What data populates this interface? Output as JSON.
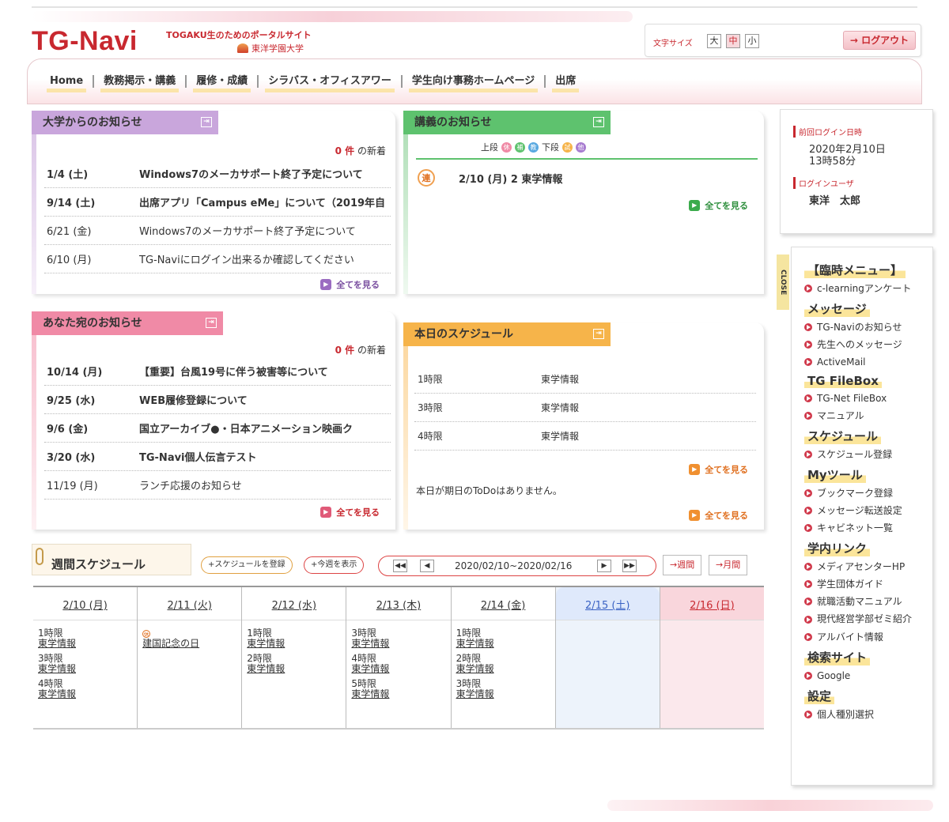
{
  "brand": {
    "logo": "TG-Navi",
    "tagline": "TOGAKU生のためのポータルサイト",
    "university": "東洋学園大学"
  },
  "toolbar": {
    "font_size_label": "文字サイズ",
    "sizes": [
      "大",
      "中",
      "小"
    ],
    "logout_label": "ログアウト"
  },
  "nav": [
    "Home",
    "教務掲示・講義",
    "履修・成績",
    "シラバス・オフィスアワー",
    "学生向け事務ホームページ",
    "出席"
  ],
  "univ_notices": {
    "title": "大学からのお知らせ",
    "new_count_num": "0 件",
    "new_count_suffix": "の新着",
    "items": [
      {
        "date": "1/4 (土)",
        "text": "Windows7のメーカサポート終了予定について"
      },
      {
        "date": "9/14 (土)",
        "text": "出席アプリ「Campus eMe」について（2019年自"
      },
      {
        "date": "6/21 (金)",
        "text": "Windows7のメーカサポート終了予定について"
      },
      {
        "date": "6/10 (月)",
        "text": "TG-Naviにログイン出来るか確認してください"
      }
    ],
    "see_all": "全てを見る"
  },
  "lecture_notices": {
    "title": "講義のお知らせ",
    "upper_label": "上段",
    "lower_label": "下段",
    "badges": [
      "休",
      "補",
      "教",
      "試",
      "他"
    ],
    "item_icon": "連",
    "item_text": "2/10 (月) 2  東学情報",
    "see_all": "全てを見る"
  },
  "my_notices": {
    "title": "あなた宛のお知らせ",
    "new_count_num": "0 件",
    "new_count_suffix": "の新着",
    "items": [
      {
        "date": "10/14 (月)",
        "text": "【重要】台風19号に伴う被害等について"
      },
      {
        "date": "9/25 (水)",
        "text": "WEB履修登録について"
      },
      {
        "date": "9/6 (金)",
        "text": "国立アーカイブ●・日本アニメーション映画ク"
      },
      {
        "date": "3/20 (水)",
        "text": "TG-Navi個人伝言テスト"
      },
      {
        "date": "11/19 (月)",
        "text": "ランチ応援のお知らせ"
      }
    ],
    "see_all": "全てを見る"
  },
  "today_schedule": {
    "title": "本日のスケジュール",
    "items": [
      {
        "period": "1時限",
        "course": "東学情報"
      },
      {
        "period": "3時限",
        "course": "東学情報"
      },
      {
        "period": "4時限",
        "course": "東学情報"
      }
    ],
    "see_all_1": "全てを見る",
    "todo_text": "本日が期日のToDoはありません。",
    "see_all_2": "全てを見る"
  },
  "login_info": {
    "last_login_label": "前回ログイン日時",
    "last_login_date": "2020年2月10日",
    "last_login_time": "13時58分",
    "user_label": "ログインユーザ",
    "user_name": "東洋　太郎"
  },
  "side_menu": {
    "close_label": "CLOSE",
    "sections": [
      {
        "title": "【臨時メニュー】",
        "items": [
          "c-learningアンケート"
        ]
      },
      {
        "title": "メッセージ",
        "items": [
          "TG-Naviのお知らせ",
          "先生へのメッセージ",
          "ActiveMail"
        ]
      },
      {
        "title": "TG FileBox",
        "items": [
          "TG-Net FileBox",
          "マニュアル"
        ]
      },
      {
        "title": "スケジュール",
        "items": [
          "スケジュール登録"
        ]
      },
      {
        "title": "Myツール",
        "items": [
          "ブックマーク登録",
          "メッセージ転送設定",
          "キャビネット一覧"
        ]
      },
      {
        "title": "学内リンク",
        "items": [
          "メディアセンターHP",
          "学生団体ガイド",
          "就職活動マニュアル",
          "現代経営学部ゼミ紹介",
          "アルバイト情報"
        ]
      },
      {
        "title": "検索サイト",
        "items": [
          "Google"
        ]
      },
      {
        "title": "設定",
        "items": [
          "個人種別選択"
        ]
      }
    ]
  },
  "weekly": {
    "title": "週間スケジュール",
    "register_label": "+スケジュールを登録",
    "this_week_label": "+今週を表示",
    "first": "◀◀",
    "prev": "◀",
    "range": "2020/02/10~2020/02/16",
    "next": "▶",
    "last": "▶▶",
    "week_label": "週間",
    "month_label": "月間",
    "days": [
      {
        "label": "2/10 (月)",
        "entries": [
          {
            "p": "1時限",
            "c": "東学情報"
          },
          {
            "p": "3時限",
            "c": "東学情報"
          },
          {
            "p": "4時限",
            "c": "東学情報"
          }
        ]
      },
      {
        "label": "2/11 (火)",
        "icon": "休",
        "entries": [
          {
            "p": "",
            "c": "建国記念の日"
          }
        ]
      },
      {
        "label": "2/12 (水)",
        "entries": [
          {
            "p": "1時限",
            "c": "東学情報"
          },
          {
            "p": "2時限",
            "c": "東学情報"
          }
        ]
      },
      {
        "label": "2/13 (木)",
        "entries": [
          {
            "p": "3時限",
            "c": "東学情報"
          },
          {
            "p": "4時限",
            "c": "東学情報"
          },
          {
            "p": "5時限",
            "c": "東学情報"
          }
        ]
      },
      {
        "label": "2/14 (金)",
        "entries": [
          {
            "p": "1時限",
            "c": "東学情報"
          },
          {
            "p": "2時限",
            "c": "東学情報"
          },
          {
            "p": "3時限",
            "c": "東学情報"
          }
        ]
      },
      {
        "label": "2/15 (土)",
        "entries": []
      },
      {
        "label": "2/16 (日)",
        "entries": []
      }
    ]
  },
  "colors": {
    "brand_red": "#c8282f",
    "univ_panel": "#c9a6dc",
    "lecture_panel": "#5ec26e",
    "my_panel": "#f08aa6",
    "schedule_panel": "#f6b44a"
  }
}
